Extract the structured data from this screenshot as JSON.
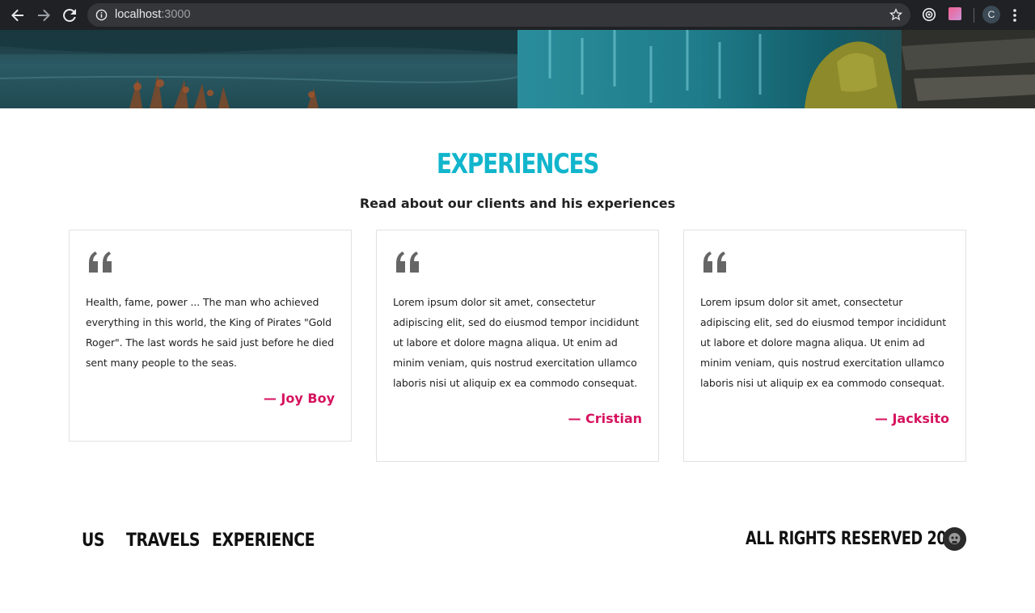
{
  "browser": {
    "url_host": "localhost",
    "url_port": ":3000",
    "profile_initial": "C"
  },
  "section": {
    "title": "EXPERIENCES",
    "subtitle": "Read about our clients and his experiences"
  },
  "testimonials": [
    {
      "text": "Health, fame, power ... The man who achieved everything in this world, the King of Pirates \"Gold Roger\". The last words he said just before he died sent many people to the seas.",
      "author": "— Joy Boy"
    },
    {
      "text": "Lorem ipsum dolor sit amet, consectetur adipiscing elit, sed do eiusmod tempor incididunt ut labore et dolore magna aliqua. Ut enim ad minim veniam, quis nostrud exercitation ullamco laboris nisi ut aliquip ex ea commodo consequat.",
      "author": "— Cristian"
    },
    {
      "text": "Lorem ipsum dolor sit amet, consectetur adipiscing elit, sed do eiusmod tempor incididunt ut labore et dolore magna aliqua. Ut enim ad minim veniam, quis nostrud exercitation ullamco laboris nisi ut aliquip ex ea commodo consequat.",
      "author": "— Jacksito"
    }
  ],
  "footer": {
    "links": [
      "US",
      "TRAVELS",
      "EXPERIENCE"
    ],
    "rights": "ALL RIGHTS RESERVED 2020"
  },
  "colors": {
    "accent": "#11b5cc",
    "author": "#d6135f",
    "quote": "#666666"
  }
}
